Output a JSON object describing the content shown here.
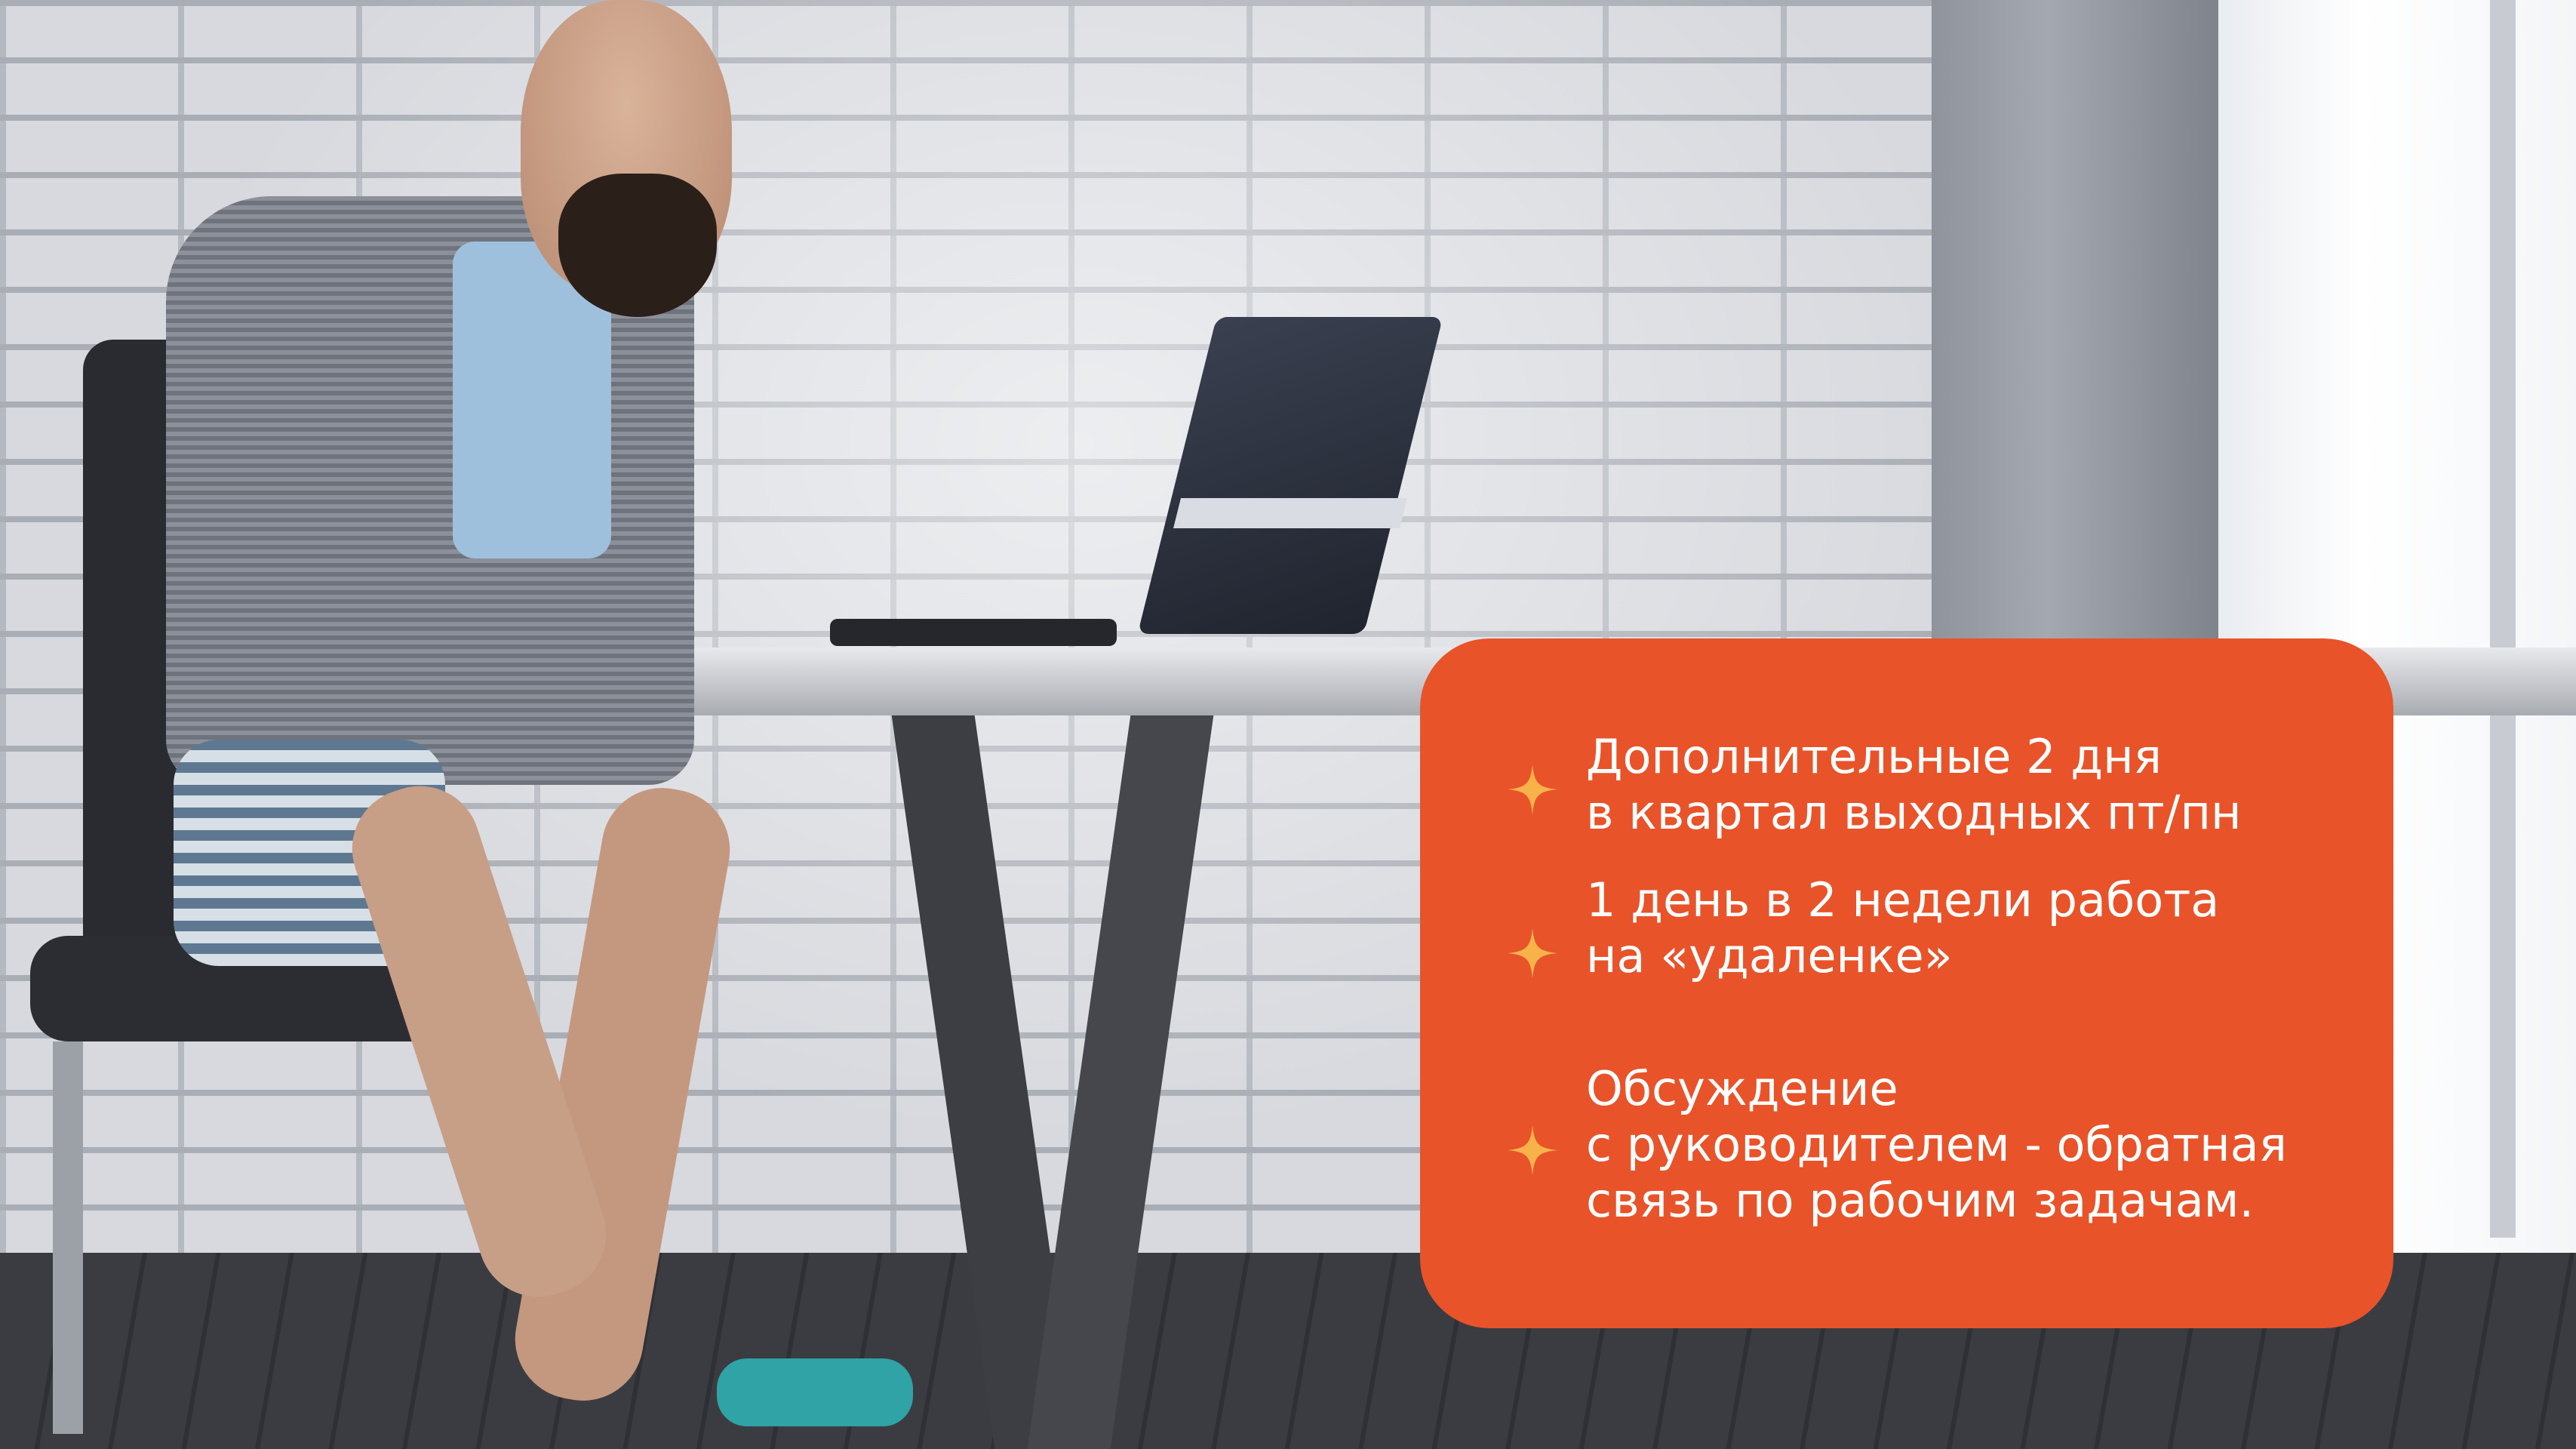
{
  "card": {
    "background_color": "#e8532a",
    "text_color": "#ffffff",
    "bullet_icon": "four-point-star-icon",
    "bullet_color": "#f7b24a",
    "items": [
      {
        "text": "Дополнительные 2 дня\nв квартал выходных пт/пн"
      },
      {
        "text": "1 день в 2 недели работа\nна «удаленке»"
      },
      {
        "text": "Обсуждение\nс руководителем - обратная\nсвязь по рабочим задачам."
      }
    ]
  }
}
